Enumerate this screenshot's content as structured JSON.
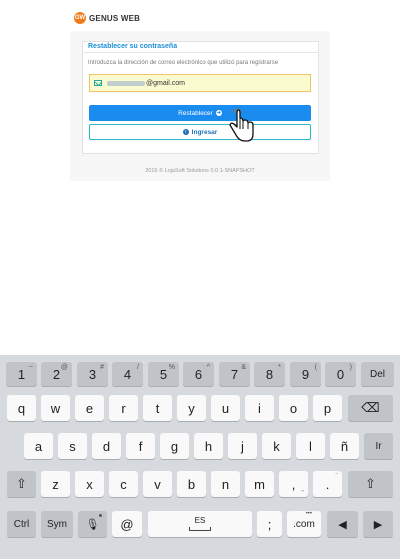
{
  "header": {
    "logo_badge": "GW",
    "brand": "GENUS WEB",
    "brand_color": "#f07a1a"
  },
  "panel": {
    "title": "Restablecer su contraseña",
    "description": "Introduzca la dirección de correo electrónico que utilizó para registrarse",
    "email_domain": "@gmail.com",
    "reset_label": "Restablecer",
    "login_label": "Ingresar",
    "accent_color": "#1a8cf0"
  },
  "footer": {
    "text": "2016 © LojaSoft Solutions 0.0.1-SNAPSHOT"
  },
  "keyboard": {
    "row1": [
      {
        "label": "1",
        "sup": "~"
      },
      {
        "label": "2",
        "sup": "@"
      },
      {
        "label": "3",
        "sup": "#"
      },
      {
        "label": "4",
        "sup": "/"
      },
      {
        "label": "5",
        "sup": "%"
      },
      {
        "label": "6",
        "sup": "^"
      },
      {
        "label": "7",
        "sup": "&"
      },
      {
        "label": "8",
        "sup": "*"
      },
      {
        "label": "9",
        "sup": "("
      },
      {
        "label": "0",
        "sup": ")"
      },
      {
        "label": "Del",
        "sup": ""
      }
    ],
    "row2": [
      "q",
      "w",
      "e",
      "r",
      "t",
      "y",
      "u",
      "i",
      "o",
      "p"
    ],
    "row3": [
      "a",
      "s",
      "d",
      "f",
      "g",
      "h",
      "j",
      "k",
      "l",
      "ñ"
    ],
    "row3_right": "Ir",
    "row4": [
      "z",
      "x",
      "c",
      "v",
      "b",
      "n",
      "m"
    ],
    "row4_comma": ",",
    "row4_comma_sub": "-",
    "row4_period": ".",
    "row4_period_sup": "¨",
    "shift_icon": "⇧",
    "backspace_icon": "⌫",
    "ctrl": "Ctrl",
    "sym": "Sym",
    "at": "@",
    "space_label": "ES",
    "semicolon": ";",
    "dotcom": ".com",
    "dotcom_sup": "•••",
    "left_icon": "◀",
    "right_icon": "▶",
    "mic_icon": "🎙"
  }
}
